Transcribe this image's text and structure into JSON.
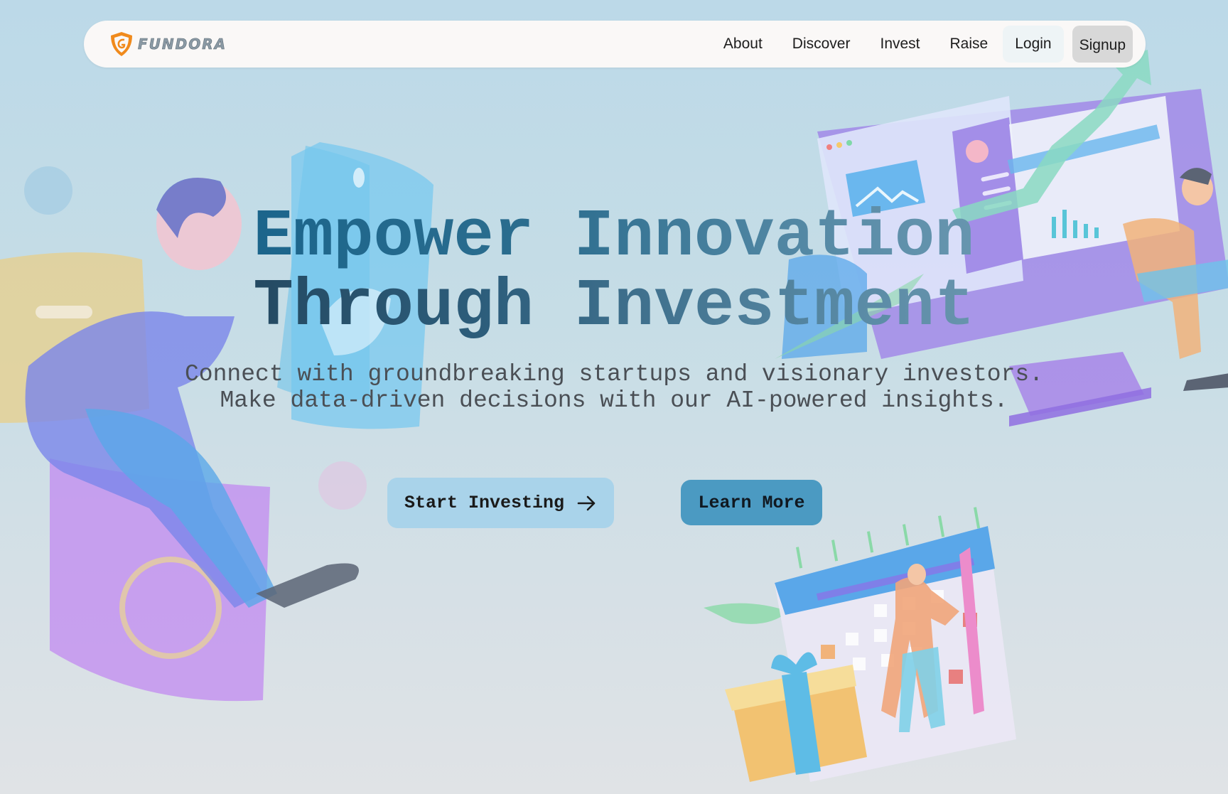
{
  "brand": {
    "name": "FUNDORA",
    "logo_icon": "shield-logo-icon",
    "logo_color": "#f08a1c"
  },
  "nav": {
    "links": [
      {
        "label": "About"
      },
      {
        "label": "Discover"
      },
      {
        "label": "Invest"
      },
      {
        "label": "Raise"
      }
    ],
    "login_label": "Login",
    "signup_label": "Signup"
  },
  "hero": {
    "title_line1": "Empower Innovation",
    "title_line2": "Through Investment",
    "subtitle_line1": "Connect with groundbreaking startups and visionary investors.",
    "subtitle_line2": "Make data-driven decisions with our AI-powered insights.",
    "primary_cta": "Start Investing",
    "primary_cta_icon": "arrow-right-icon",
    "secondary_cta": "Learn More"
  },
  "colors": {
    "primary_button": "#a9d3ea",
    "secondary_button": "#4b9ac2",
    "title_accent": "#0c5d88"
  }
}
